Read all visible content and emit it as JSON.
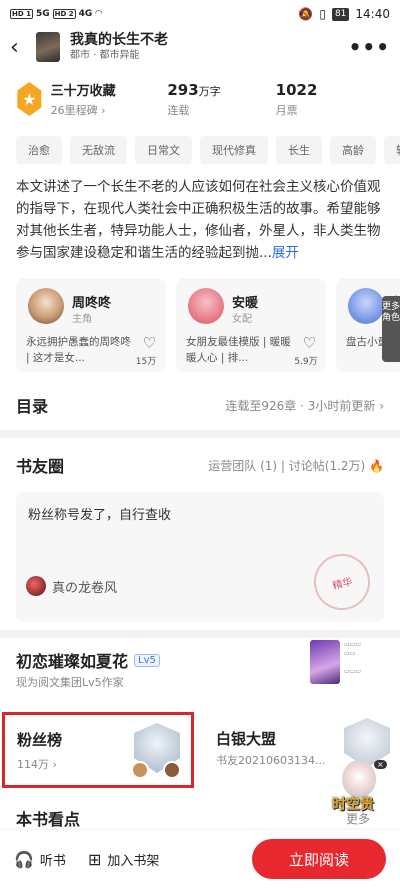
{
  "status_bar": {
    "time": "14:40",
    "battery": "81",
    "left": [
      "HD 1",
      "5G",
      "HD 2",
      "4G"
    ]
  },
  "header": {
    "back_icon": "chevron-left-icon",
    "title": "我真的长生不老",
    "subtitle": "都市 · 都市异能",
    "more_icon": "more-dots-icon"
  },
  "stats": {
    "collect": {
      "value": "三十万收藏",
      "label": "26里程碑"
    },
    "words": {
      "value": "293",
      "unit": "万字",
      "label": "连载"
    },
    "tickets": {
      "value": "1022",
      "label": "月票"
    }
  },
  "tags": [
    "治愈",
    "无敌流",
    "日常文",
    "现代修真",
    "长生",
    "高龄",
    "轻"
  ],
  "description": {
    "text": "本文讲述了一个长生不老的人应该如何在社会主义核心价值观的指导下，在现代人类社会中正确积极生活的故事。希望能够对其他长生者，特异功能人士，修仙者，外星人，非人类生物参与国家建设稳定和谐生活的经验起到抛...",
    "expand": "展开"
  },
  "characters": [
    {
      "name": "周咚咚",
      "role": "主角",
      "desc": "永远拥护愚蠢的周咚咚 | 这才是女...",
      "likes": "15万",
      "avatar": "#b07a5a"
    },
    {
      "name": "安暖",
      "role": "女配",
      "desc": "女朋友最佳模版 | 暖暖暖人心 | 排...",
      "likes": "5.9万",
      "avatar": "#e87d8a"
    },
    {
      "name": "刘",
      "role": "",
      "desc": "盘古小童 | 刘爷爷恋爱",
      "likes": "",
      "avatar": "#7a9ae8"
    }
  ],
  "side_tab": "更多角色",
  "catalog": {
    "title": "目录",
    "meta": "连载至926章 · 3小时前更新"
  },
  "circle": {
    "title": "书友圈",
    "meta_team": "运营团队 (1)",
    "meta_posts": "讨论帖(1.2万)",
    "post_text": "粉丝称号发了，自行查收",
    "post_user": "真の龙卷风",
    "stamp": "精华"
  },
  "author": {
    "name": "初恋璀璨如夏花",
    "level": "Lv5",
    "sub": "现为阅文集团Lv5作家"
  },
  "fans": {
    "title": "粉丝榜",
    "count": "114万"
  },
  "silver": {
    "title": "白银大盟",
    "sub": "书友20210603134..."
  },
  "promo": {
    "text": "时空贵"
  },
  "points": {
    "title": "本书看点",
    "more": "更多"
  },
  "bottom_bar": {
    "listen": "听书",
    "shelf": "加入书架",
    "read": "立即阅读"
  },
  "colors": {
    "accent": "#e8282f",
    "badge": "#f5a623",
    "link": "#2b6de0"
  }
}
